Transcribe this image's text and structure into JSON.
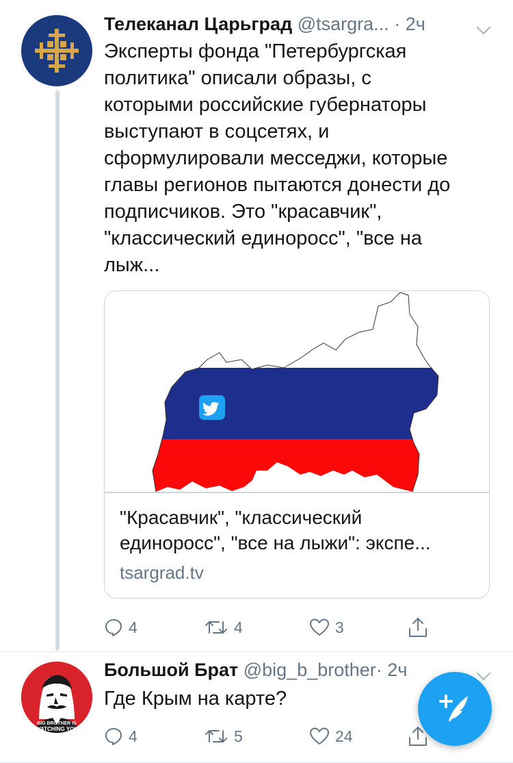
{
  "tweet1": {
    "author_name": "Телеканал Царьград",
    "author_handle": "@tsargra...",
    "separator": " · ",
    "time": "2ч",
    "text": "Эксперты фонда \"Петербургская\nполитика\" описали образы, с\nкоторыми российские губернаторы\nвыступают в соцсетях, и\nсформулировали месседжи, которые\nглавы регионов пытаются донести до\nподписчиков. Это \"красавчик\",\n\"классический единоросс\", \"все на\nлыж...",
    "card": {
      "title": "\"Красавчик\", \"классический\nединоросс\", \"все на лыжи\": экспе...",
      "domain": "tsargrad.tv"
    },
    "replies": "4",
    "retweets": "4",
    "likes": "3"
  },
  "tweet2": {
    "author_name": "Большой Брат",
    "author_handle": "@big_b_brother",
    "separator": "·",
    "time": "2ч",
    "text": "Где Крым на карте?",
    "replies": "4",
    "retweets": "5",
    "likes": "24",
    "avatar_caption": "BIG BROTHER IS WATCHING YOU"
  },
  "icons": {
    "reply": "reply-icon",
    "retweet": "retweet-icon",
    "like": "heart-icon",
    "share": "share-icon",
    "more": "chevron-down-icon",
    "compose": "compose-tweet-icon"
  },
  "colors": {
    "accent": "#1da1f2",
    "text_primary": "#14171a",
    "text_secondary": "#657786",
    "border": "#ccd6dd",
    "flag_white": "#ffffff",
    "flag_blue": "#1e2e8c",
    "flag_red": "#fb0808",
    "avatar1_bg": "#1b3a7e",
    "avatar1_emblem": "#d8a64a",
    "avatar2_bg": "#d8232a"
  }
}
